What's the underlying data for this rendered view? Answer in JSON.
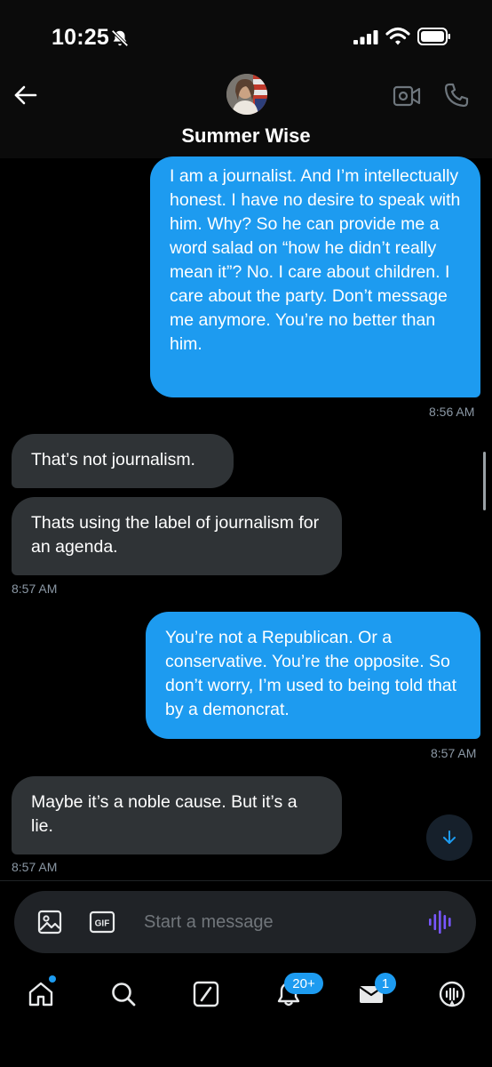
{
  "status_bar": {
    "time": "10:25"
  },
  "header": {
    "contact_name": "Summer Wise"
  },
  "messages": [
    {
      "direction": "sent",
      "text": "I am a journalist.  And I’m intellectually honest.  I have no desire to speak with him. Why? So he can provide me a word salad on “how he didn’t really mean it”?  No.  I care about children.  I care about the party.  Don’t message me anymore.  You’re no better than him.",
      "time": "8:56 AM"
    },
    {
      "direction": "received",
      "text": "That’s not journalism.",
      "time": ""
    },
    {
      "direction": "received",
      "text": "Thats using the label of journalism for an agenda.",
      "time": "8:57 AM"
    },
    {
      "direction": "sent",
      "text": "You’re not a Republican. Or a conservative.  You’re the opposite.  So don’t worry, I’m used to being told that by a demoncrat.",
      "time": "8:57 AM"
    },
    {
      "direction": "received",
      "text": "Maybe it’s a noble cause. But it’s a lie.",
      "time": "8:57 AM"
    }
  ],
  "composer": {
    "placeholder": "Start a message",
    "gif_label": "GIF"
  },
  "nav": {
    "items": [
      "home-icon",
      "search-icon",
      "grok-icon",
      "notifications-icon",
      "messages-icon",
      "communities-icon"
    ],
    "notifications_badge": "20+",
    "messages_badge": "1"
  },
  "colors": {
    "sent_bubble": "#1d9bf0",
    "received_bubble": "#2f3336",
    "background": "#000000",
    "accent_voice": "#7856ff"
  }
}
